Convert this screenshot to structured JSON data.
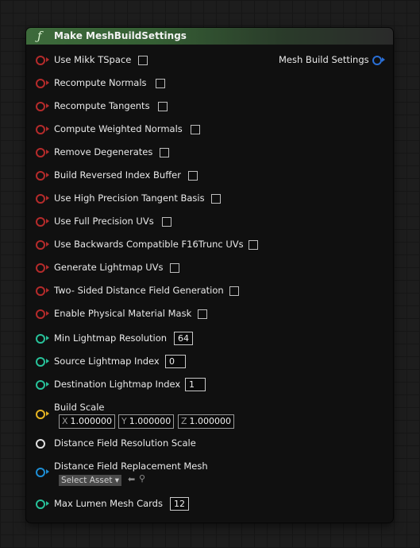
{
  "node": {
    "icon": "function-icon",
    "title": "Make MeshBuildSettings",
    "output_label": "Mesh Build Settings"
  },
  "bool_inputs": [
    {
      "label": "Use Mikk TSpace"
    },
    {
      "label": "Recompute Normals"
    },
    {
      "label": "Recompute Tangents"
    },
    {
      "label": "Compute Weighted Normals"
    },
    {
      "label": "Remove Degenerates"
    },
    {
      "label": "Build Reversed Index Buffer"
    },
    {
      "label": "Use High Precision Tangent Basis"
    },
    {
      "label": "Use Full Precision UVs"
    },
    {
      "label": "Use Backwards Compatible F16Trunc UVs"
    },
    {
      "label": "Generate Lightmap UVs"
    },
    {
      "label": "Two- Sided Distance Field Generation"
    },
    {
      "label": "Enable Physical Material Mask"
    }
  ],
  "int_inputs": {
    "min_lightmap": {
      "label": "Min Lightmap Resolution",
      "value": "64"
    },
    "source_lightmap": {
      "label": "Source Lightmap Index",
      "value": "0"
    },
    "dest_lightmap": {
      "label": "Destination Lightmap Index",
      "value": "1"
    }
  },
  "build_scale": {
    "label": "Build Scale",
    "x_axis": "X",
    "x": "1.000000",
    "y_axis": "Y",
    "y": "1.000000",
    "z_axis": "Z",
    "z": "1.000000"
  },
  "distance_field_resolution_scale": {
    "label": "Distance Field Resolution Scale"
  },
  "distance_field_replacement_mesh": {
    "label": "Distance Field Replacement Mesh",
    "select_label": "Select Asset"
  },
  "max_lumen": {
    "label": "Max Lumen Mesh Cards",
    "value": "12"
  },
  "colors": {
    "bool_pin": "#b52b2b",
    "int_pin": "#28c29a",
    "vector_pin": "#e6b422",
    "float_pin": "#e0e0e0",
    "object_pin": "#1e8fd6",
    "struct_pin": "#2a6fd6",
    "header_green": "#3d6a3b"
  }
}
